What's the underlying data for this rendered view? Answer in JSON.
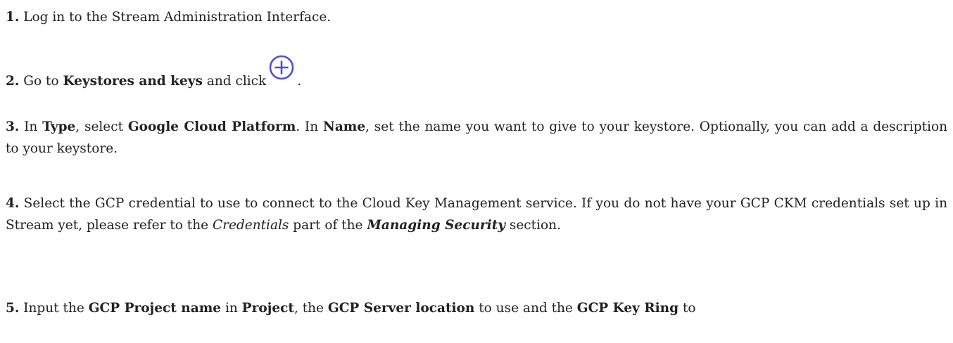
{
  "steps": {
    "s1": {
      "num": "1.",
      "text": " Log in to the Stream Administration Interface."
    },
    "s2": {
      "num": "2.",
      "t1": " Go to ",
      "b1": "Keystores and keys",
      "t2": " and click",
      "t3": "."
    },
    "s3": {
      "num": "3.",
      "t1": " In ",
      "b1": "Type",
      "t2": ", select ",
      "b2": "Google Cloud Platform",
      "t3": ". In ",
      "b3": "Name",
      "t4": ", set the name you want to give to your keystore. Optionally, you can add a description to your keystore."
    },
    "s4": {
      "num": "4.",
      "t1": " Select the GCP credential to use to connect to the Cloud Key Management service. If you do not have your GCP CKM credentials set up in Stream yet, please refer to the ",
      "i1": "Credentials",
      "t2": " part of the ",
      "bi1": "Managing Security",
      "t3": " section."
    },
    "s5": {
      "num": "5.",
      "t1": " Input the ",
      "b1": "GCP Project name",
      "t2": " in ",
      "b2": "Project",
      "t3": ", the ",
      "b3": "GCP Server location",
      "t4": " to use and the ",
      "b4": "GCP Key Ring",
      "t5": " to"
    }
  },
  "icons": {
    "add": "plus-circle-icon"
  },
  "colors": {
    "text": "#222222",
    "icon": "#4f4fd6"
  }
}
